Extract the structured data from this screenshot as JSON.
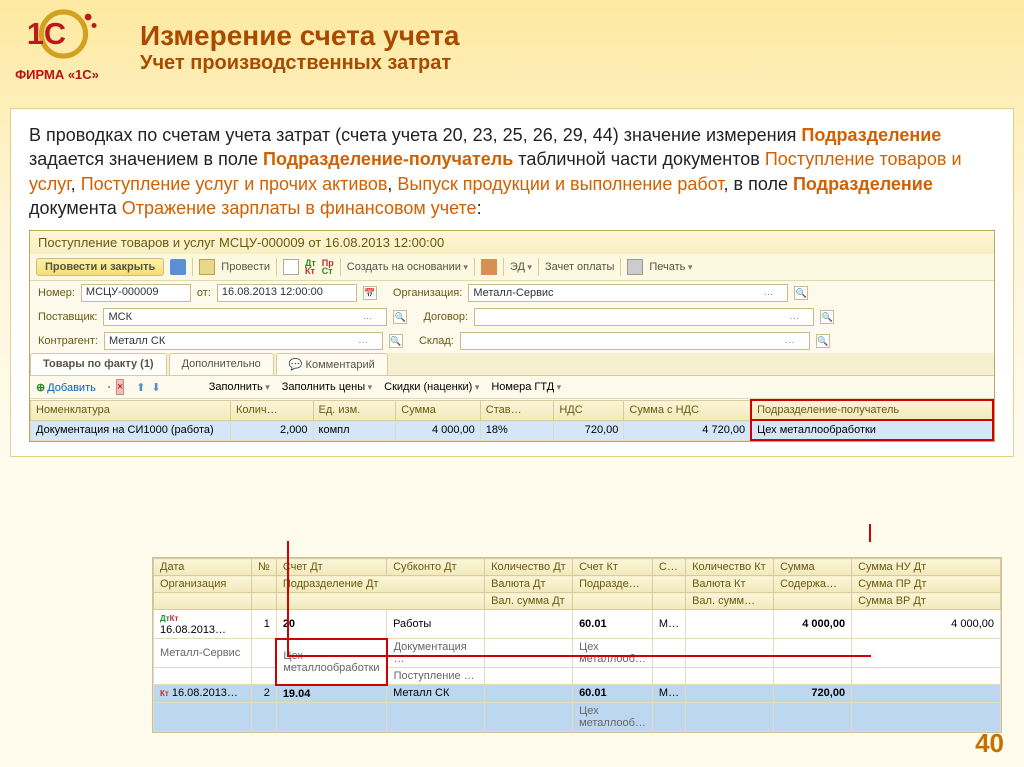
{
  "logo_caption": "ФИРМА «1С»",
  "title": {
    "main": "Измерение счета учета",
    "sub": "Учет производственных затрат"
  },
  "prose": {
    "p1a": "В проводках по счетам учета затрат (счета учета 20, 23, 25, 26, 29, 44) значение измерения ",
    "p1b": "Подразделение",
    "p1c": " задается значением в поле ",
    "p1d": "Подразделение-получатель",
    "p1e": " табличной части документов ",
    "p1f": "Поступление товаров и услуг",
    "p1g": ", ",
    "p1h": "Поступление услуг и прочих активов",
    "p1i": ", ",
    "p1j": "Выпуск продукции и выполнение работ",
    "p1k": ", в поле ",
    "p1l": "Подразделение",
    "p1m": " документа ",
    "p1n": "Отражение зарплаты в финансовом учете",
    "p1o": ":"
  },
  "window": {
    "title": "Поступление товаров и услуг МСЦУ-000009 от 16.08.2013 12:00:00",
    "toolbar": {
      "post_close": "Провести и закрыть",
      "post": "Провести",
      "create_based": "Создать на основании",
      "ed": "ЭД",
      "offset": "Зачет оплаты",
      "print": "Печать"
    },
    "form": {
      "num_lbl": "Номер:",
      "num_val": "МСЦУ-000009",
      "date_lbl": "от:",
      "date_val": "16.08.2013 12:00:00",
      "org_lbl": "Организация:",
      "org_val": "Металл-Сервис",
      "supplier_lbl": "Поставщик:",
      "supplier_val": "МСК",
      "contract_lbl": "Договор:",
      "contract_val": "",
      "contragent_lbl": "Контрагент:",
      "contragent_val": "Металл СК",
      "stock_lbl": "Склад:",
      "stock_val": ""
    },
    "tabs": {
      "t1": "Товары по факту (1)",
      "t2": "Дополнительно",
      "t3": "Комментарий"
    },
    "grid_tb": {
      "add": "Добавить",
      "fill": "Заполнить",
      "fill_prices": "Заполнить цены",
      "discounts": "Скидки (наценки)",
      "gtd": "Номера ГТД"
    },
    "grid_hdr": {
      "nom": "Номенклатура",
      "qty": "Колич…",
      "unit": "Ед. изм.",
      "sum": "Сумма",
      "rate": "Став…",
      "vat": "НДС",
      "sum_vat": "Сумма с НДС",
      "dept": "Подразделение-получатель"
    },
    "grid_row": {
      "nom": "Документация на СИ1000 (работа)",
      "qty": "2,000",
      "unit": "компл",
      "sum": "4 000,00",
      "rate": "18%",
      "vat": "720,00",
      "sum_vat": "4 720,00",
      "dept": "Цех металлообработки"
    }
  },
  "reg": {
    "hdr1": {
      "date": "Дата",
      "n": "№",
      "dt": "Счет Дт",
      "sub": "Субконто Дт",
      "qtydt": "Количество Дт",
      "kt": "Счет Кт",
      "s": "С…",
      "qtykt": "Количество Кт",
      "sum": "Сумма",
      "sumnu": "Сумма НУ Дт"
    },
    "hdr2": {
      "org": "Организация",
      "deptdt": "Подразделение Дт",
      "cur": "Валюта Дт",
      "deptkt": "Подразде…",
      "curkt": "Валюта Кт",
      "cont": "Содержа…",
      "sumpr": "Сумма ПР Дт"
    },
    "hdr3": {
      "valsum": "Вал. сумма Дт",
      "valsumkt": "Вал. сумм…",
      "sumvr": "Сумма ВР Дт"
    },
    "r1a": {
      "date": "16.08.2013…",
      "n": "1",
      "dt": "20",
      "sub": "Работы",
      "kt": "60.01",
      "s": "М…",
      "sum": "4 000,00",
      "sumnu": "4 000,00"
    },
    "r1b": {
      "org": "Металл-Сервис",
      "deptdt": "Цех металлообработки",
      "sub": "Документация …",
      "deptkt": "Цех металлооб…"
    },
    "r1c": {
      "sub": "Поступление …"
    },
    "r2a": {
      "date": "16.08.2013…",
      "n": "2",
      "dt": "19.04",
      "sub": "Металл СК",
      "kt": "60.01",
      "s": "М…",
      "sum": "720,00"
    },
    "r2b": {
      "deptkt": "Цех металлооб…"
    }
  },
  "page_num": "40"
}
